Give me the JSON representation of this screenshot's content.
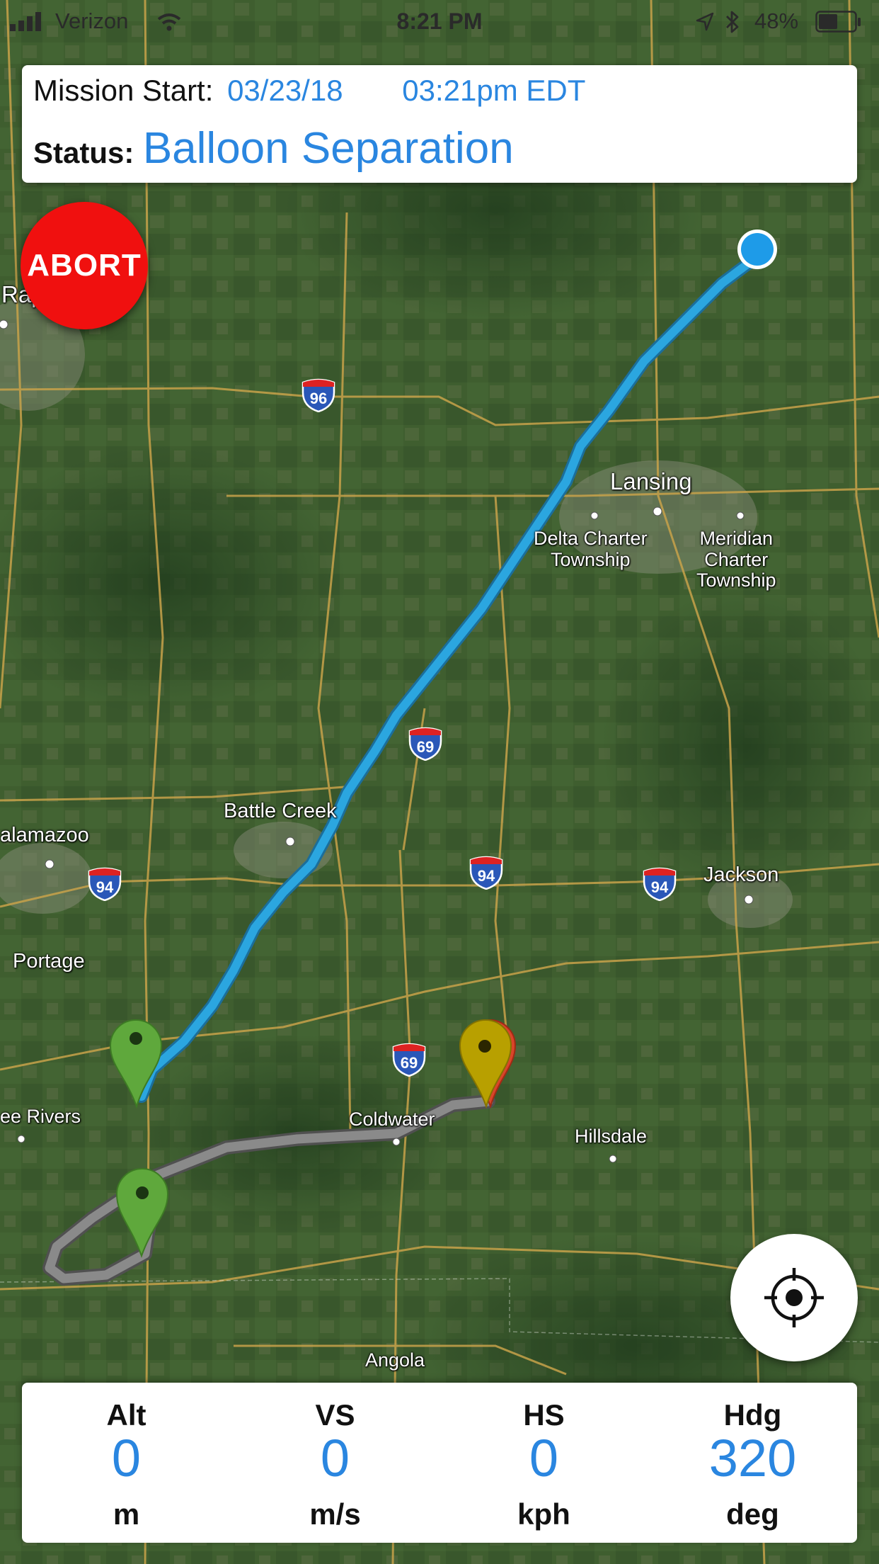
{
  "status_bar": {
    "carrier": "Verizon",
    "time": "8:21 PM",
    "battery": "48%",
    "icons": [
      "signal-icon",
      "wifi-icon",
      "location-arrow-icon",
      "bluetooth-icon",
      "battery-icon"
    ]
  },
  "mission": {
    "start_label": "Mission Start:",
    "date": "03/23/18",
    "time": "03:21pm EDT",
    "status_label": "Status:",
    "status_value": "Balloon Separation"
  },
  "abort_button": {
    "label": "ABORT",
    "color": "#f0100f"
  },
  "map": {
    "places": {
      "rapids": "Rap",
      "lansing": "Lansing",
      "delta_charter": [
        "Delta Charter",
        "Township"
      ],
      "meridian_charter": [
        "Meridian",
        "Charter",
        "Township"
      ],
      "battle_creek": "Battle Creek",
      "kalamazoo": "alamazoo",
      "jackson": "Jackson",
      "portage": "Portage",
      "three_rivers": "ee Rivers",
      "coldwater": "Coldwater",
      "hillsdale": "Hillsdale",
      "angola": "Angola"
    },
    "shields": {
      "i96": "96",
      "i69_north": "69",
      "i69_south": "69",
      "i94_west": "94",
      "i94_mid": "94",
      "i94_east": "94"
    },
    "flight_path_color": "#2ba6e0",
    "ground_path_color": "#8a8a8a",
    "balloon_marker_color": "#1e9be8",
    "pin_colors": {
      "green": "#5fa83c",
      "yellow": "#b8a000",
      "red": "#d9452a"
    }
  },
  "telemetry": {
    "altitude": {
      "label": "Alt",
      "value": "0",
      "unit": "m"
    },
    "vertical_speed": {
      "label": "VS",
      "value": "0",
      "unit": "m/s"
    },
    "horizontal_speed": {
      "label": "HS",
      "value": "0",
      "unit": "kph"
    },
    "heading": {
      "label": "Hdg",
      "value": "320",
      "unit": "deg"
    }
  }
}
